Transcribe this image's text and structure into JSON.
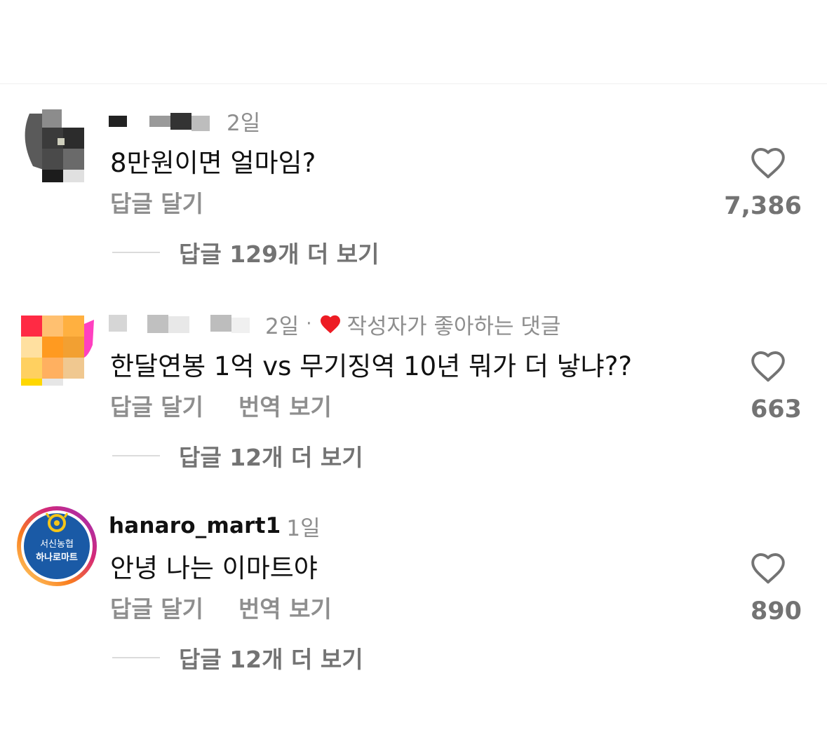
{
  "comments": [
    {
      "username": "",
      "time": "2일",
      "text": "8만원이면 얼마임?",
      "reply_label": "답글 달기",
      "translate_label": "",
      "view_replies": "답글 129개 더 보기",
      "likes": "7,386"
    },
    {
      "username": "",
      "time": "2일",
      "liked_by_author": "작성자가 좋아하는 댓글",
      "text": "한달연봉 1억 vs 무기징역 10년 뭐가 더 낳냐??",
      "reply_label": "답글 달기",
      "translate_label": "번역 보기",
      "view_replies": "답글 12개 더 보기",
      "likes": "663"
    },
    {
      "username": "hanaro_mart1",
      "time": "1일",
      "text": "안녕 나는 이마트야",
      "reply_label": "답글 달기",
      "translate_label": "번역 보기",
      "view_replies": "답글 12개 더 보기",
      "likes": "890",
      "avatar_text_top": "서신농협",
      "avatar_text_bottom": "하나로마트"
    }
  ],
  "colors": {
    "secondary_text": "#8e8e8e",
    "liked_heart": "#ed1c24",
    "divider": "#efefef",
    "brand_blue": "#1a5aa6"
  },
  "icons": {
    "like": "heart-outline-icon",
    "author_like": "heart-filled-icon"
  }
}
